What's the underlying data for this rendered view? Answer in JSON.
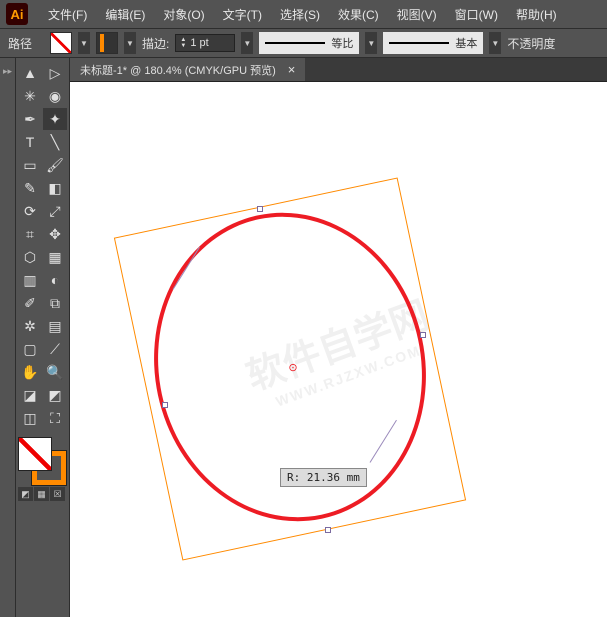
{
  "app": {
    "logo": "Ai"
  },
  "menu": {
    "file": "文件(F)",
    "edit": "编辑(E)",
    "object": "对象(O)",
    "type": "文字(T)",
    "select": "选择(S)",
    "effect": "效果(C)",
    "view": "视图(V)",
    "window": "窗口(W)",
    "help": "帮助(H)"
  },
  "options": {
    "path_label": "路径",
    "stroke_label": "描边:",
    "stroke_value": "1 pt",
    "profile_label": "等比",
    "brush_label": "基本",
    "opacity_label": "不透明度"
  },
  "tab": {
    "title": "未标题-1* @ 180.4%  (CMYK/GPU 预览)"
  },
  "tooltip": {
    "radius": "R: 21.36 mm"
  },
  "watermark": {
    "main": "软件自学网",
    "sub": "WWW.RJZXW.COM"
  },
  "tools": {
    "selection": "selection",
    "direct": "direct-select",
    "magic": "magic-wand",
    "lasso": "lasso",
    "pen": "pen",
    "curvature": "curvature",
    "type": "type",
    "line": "line",
    "rect": "rectangle",
    "brush": "paintbrush",
    "shaper": "shaper",
    "eraser": "eraser",
    "rotate": "rotate",
    "scale": "scale",
    "width": "width",
    "free": "free-transform",
    "shape_builder": "shape-builder",
    "perspective": "perspective",
    "mesh": "mesh",
    "gradient": "gradient",
    "eyedrop": "eyedropper",
    "blend": "blend",
    "symbol": "symbol-sprayer",
    "graph": "column-graph",
    "artboard": "artboard",
    "slice": "slice",
    "hand": "hand",
    "zoom": "zoom",
    "t1": "fill",
    "t2": "stroke"
  }
}
